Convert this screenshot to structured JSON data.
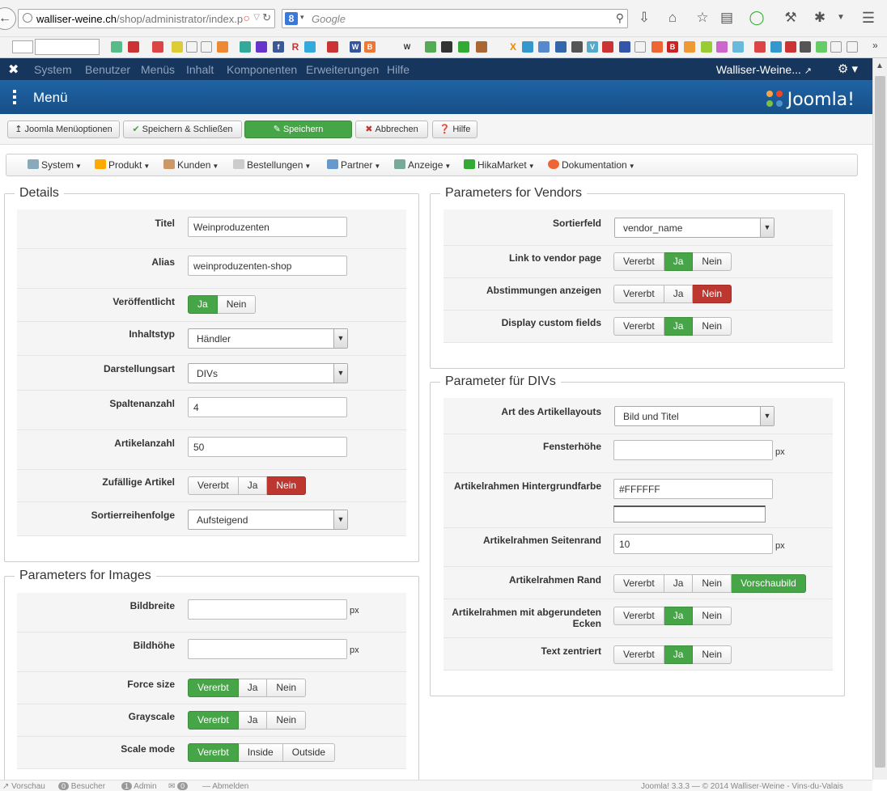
{
  "browser": {
    "url_host": "walliser-weine.ch",
    "url_path": "/shop/administrator/index.p",
    "search_placeholder": "Google"
  },
  "admin_nav": {
    "items": [
      "System",
      "Benutzer",
      "Menüs",
      "Inhalt",
      "Komponenten",
      "Erweiterungen",
      "Hilfe"
    ],
    "site_name": "Walliser-Weine..."
  },
  "page": {
    "title": "Menü",
    "brand": "Joomla!"
  },
  "toolbar": {
    "options": "Joomla Menüoptionen",
    "save_close": "Speichern & Schließen",
    "save": "Speichern",
    "cancel": "Abbrechen",
    "help": "Hilfe"
  },
  "hika_menu": [
    "System",
    "Produkt",
    "Kunden",
    "Bestellungen",
    "Partner",
    "Anzeige",
    "HikaMarket",
    "Dokumentation"
  ],
  "details": {
    "legend": "Details",
    "titel_label": "Titel",
    "titel_value": "Weinproduzenten",
    "alias_label": "Alias",
    "alias_value": "weinproduzenten-shop",
    "published_label": "Veröffentlicht",
    "published_yes": "Ja",
    "published_no": "Nein",
    "content_type_label": "Inhaltstyp",
    "content_type_value": "Händler",
    "display_label": "Darstellungsart",
    "display_value": "DIVs",
    "columns_label": "Spaltenanzahl",
    "columns_value": "4",
    "article_count_label": "Artikelanzahl",
    "article_count_value": "50",
    "random_label": "Zufällige Artikel",
    "sort_order_label": "Sortierreihenfolge",
    "sort_order_value": "Aufsteigend"
  },
  "images": {
    "legend": "Parameters for Images",
    "width_label": "Bildbreite",
    "height_label": "Bildhöhe",
    "force_label": "Force size",
    "gray_label": "Grayscale",
    "scale_label": "Scale mode",
    "scale_inside": "Inside",
    "scale_outside": "Outside"
  },
  "vendors": {
    "legend": "Parameters for Vendors",
    "sort_field_label": "Sortierfeld",
    "sort_field_value": "vendor_name",
    "link_label": "Link to vendor page",
    "votes_label": "Abstimmungen anzeigen",
    "custom_label": "Display custom fields"
  },
  "divs": {
    "legend": "Parameter für DIVs",
    "layout_label": "Art des Artikellayouts",
    "layout_value": "Bild und Titel",
    "window_height_label": "Fensterhöhe",
    "bg_label": "Artikelrahmen Hintergrundfarbe",
    "bg_value": "#FFFFFF",
    "margin_label": "Artikelrahmen Seitenrand",
    "margin_value": "10",
    "border_label": "Artikelrahmen Rand",
    "border_preview": "Vorschaubild",
    "rounded_label_1": "Artikelrahmen mit abgerundeten",
    "rounded_label_2": "Ecken",
    "center_label": "Text zentriert"
  },
  "common": {
    "inherited": "Vererbt",
    "yes": "Ja",
    "no": "Nein",
    "px": "px"
  },
  "status_bar": {
    "preview": "Vorschau",
    "visitors_count": "0",
    "visitors": "Besucher",
    "admin_count": "1",
    "admin": "Admin",
    "msg_count": "0",
    "logout": "Abmelden",
    "version": "Joomla! 3.3.3",
    "copyright": "— © 2014 Walliser-Weine - Vins-du-Valais"
  }
}
